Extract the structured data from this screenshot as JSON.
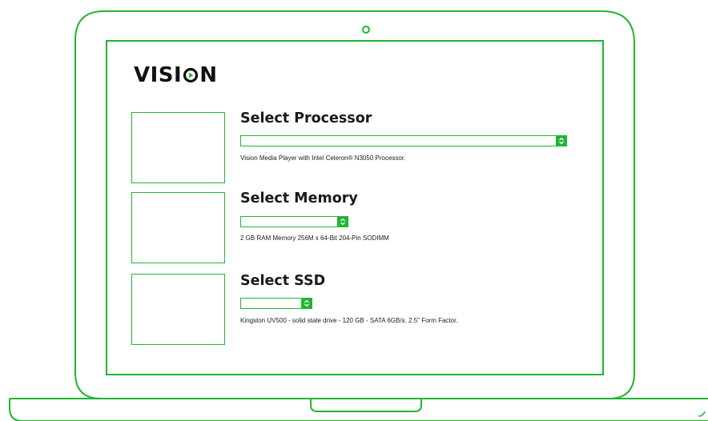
{
  "brand": {
    "logo_prefix": "VISI",
    "logo_suffix": "N",
    "accent_color": "#21b534"
  },
  "sections": [
    {
      "title": "Select Processor",
      "selected_value": "",
      "description": "Vision Media Player with Intel Celeron® N3050 Processor."
    },
    {
      "title": "Select Memory",
      "selected_value": "",
      "description": "2 GB RAM Memory 256M x 64-Bit 204-Pin SODIMM"
    },
    {
      "title": "Select SSD",
      "selected_value": "",
      "description": "Kingston UV500 - solid state drive - 120 GB - SATA 6GB/s. 2.5\" Form Factor."
    }
  ],
  "icons": {
    "dropdown": "chevron-updown-icon",
    "camera": "webcam-icon",
    "logo_mark": "play-icon"
  }
}
